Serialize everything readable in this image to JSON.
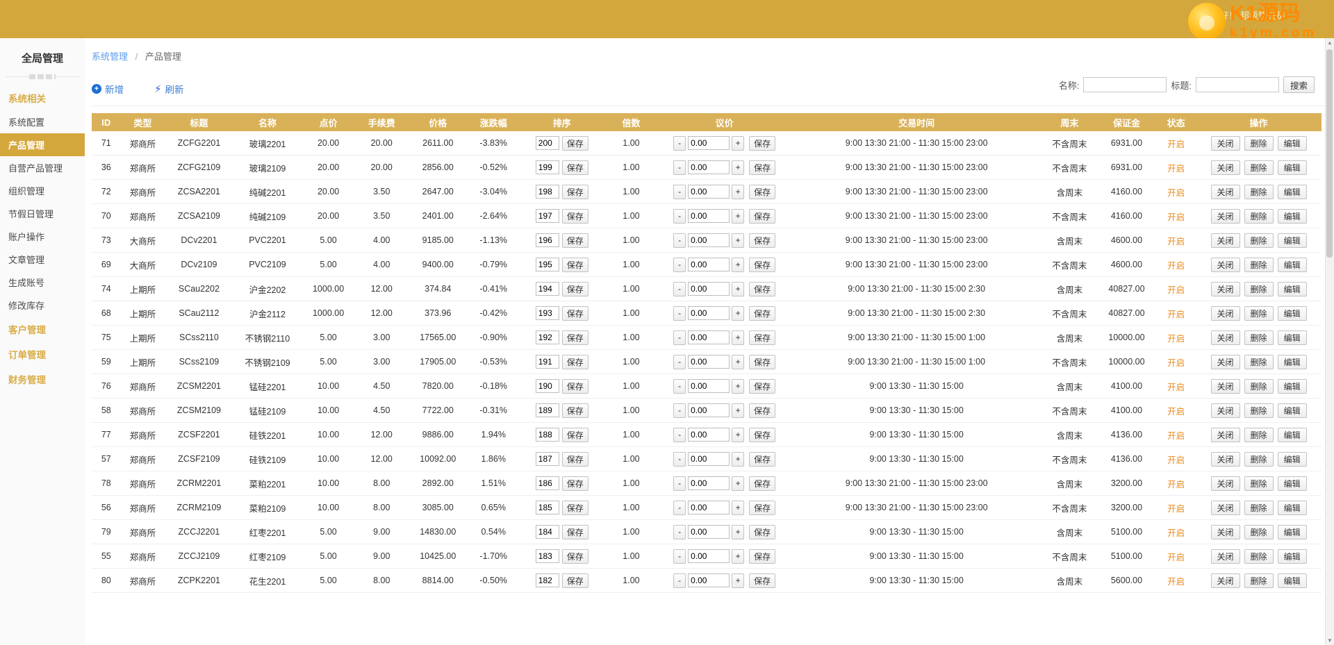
{
  "topbar": {
    "greeting": "你好！ 超级管理员",
    "logo_title": "K1源码",
    "logo_sub": "k1ym.com"
  },
  "sidebar": {
    "title": "全局管理",
    "groups": [
      {
        "label": "系统相关",
        "items": [
          {
            "label": "系统配置",
            "active": false
          },
          {
            "label": "产品管理",
            "active": true
          },
          {
            "label": "自营产品管理",
            "active": false
          },
          {
            "label": "组织管理",
            "active": false
          },
          {
            "label": "节假日管理",
            "active": false
          },
          {
            "label": "账户操作",
            "active": false
          },
          {
            "label": "文章管理",
            "active": false
          },
          {
            "label": "生成账号",
            "active": false
          },
          {
            "label": "修改库存",
            "active": false
          }
        ]
      },
      {
        "label": "客户管理",
        "items": []
      },
      {
        "label": "订单管理",
        "items": []
      },
      {
        "label": "财务管理",
        "items": []
      }
    ]
  },
  "breadcrumb": {
    "root": "系统管理",
    "separator": "/",
    "current": "产品管理"
  },
  "toolbar": {
    "add_label": "新增",
    "add_icon": "plus-circle-icon",
    "refresh_label": "刷新",
    "refresh_icon": "refresh-icon",
    "search": {
      "name_label": "名称:",
      "name_value": "",
      "title_label": "标题:",
      "title_value": "",
      "button_label": "搜索"
    }
  },
  "table": {
    "columns": [
      "ID",
      "类型",
      "标题",
      "名称",
      "点价",
      "手续费",
      "价格",
      "涨跌幅",
      "排序",
      "倍数",
      "议价",
      "交易时间",
      "周末",
      "保证金",
      "状态",
      "操作"
    ],
    "save_label": "保存",
    "minus_label": "-",
    "plus_label": "+",
    "status_on_label": "开启",
    "ops": [
      "关闭",
      "删除",
      "编辑"
    ],
    "rows": [
      {
        "id": "71",
        "type": "郑商所",
        "title": "ZCFG2201",
        "name": "玻璃2201",
        "point": "20.00",
        "fee": "20.00",
        "price": "2611.00",
        "change": "-3.83%",
        "sort": "200",
        "mult": "1.00",
        "bid": "0.00",
        "time": "9:00 13:30 21:00 - 11:30 15:00 23:00",
        "weekend": "不含周末",
        "margin": "6931.00",
        "status": "开启"
      },
      {
        "id": "36",
        "type": "郑商所",
        "title": "ZCFG2109",
        "name": "玻璃2109",
        "point": "20.00",
        "fee": "20.00",
        "price": "2856.00",
        "change": "-0.52%",
        "sort": "199",
        "mult": "1.00",
        "bid": "0.00",
        "time": "9:00 13:30 21:00 - 11:30 15:00 23:00",
        "weekend": "不含周末",
        "margin": "6931.00",
        "status": "开启"
      },
      {
        "id": "72",
        "type": "郑商所",
        "title": "ZCSA2201",
        "name": "纯碱2201",
        "point": "20.00",
        "fee": "3.50",
        "price": "2647.00",
        "change": "-3.04%",
        "sort": "198",
        "mult": "1.00",
        "bid": "0.00",
        "time": "9:00 13:30 21:00 - 11:30 15:00 23:00",
        "weekend": "含周末",
        "margin": "4160.00",
        "status": "开启"
      },
      {
        "id": "70",
        "type": "郑商所",
        "title": "ZCSA2109",
        "name": "纯碱2109",
        "point": "20.00",
        "fee": "3.50",
        "price": "2401.00",
        "change": "-2.64%",
        "sort": "197",
        "mult": "1.00",
        "bid": "0.00",
        "time": "9:00 13:30 21:00 - 11:30 15:00 23:00",
        "weekend": "不含周末",
        "margin": "4160.00",
        "status": "开启"
      },
      {
        "id": "73",
        "type": "大商所",
        "title": "DCv2201",
        "name": "PVC2201",
        "point": "5.00",
        "fee": "4.00",
        "price": "9185.00",
        "change": "-1.13%",
        "sort": "196",
        "mult": "1.00",
        "bid": "0.00",
        "time": "9:00 13:30 21:00 - 11:30 15:00 23:00",
        "weekend": "含周末",
        "margin": "4600.00",
        "status": "开启"
      },
      {
        "id": "69",
        "type": "大商所",
        "title": "DCv2109",
        "name": "PVC2109",
        "point": "5.00",
        "fee": "4.00",
        "price": "9400.00",
        "change": "-0.79%",
        "sort": "195",
        "mult": "1.00",
        "bid": "0.00",
        "time": "9:00 13:30 21:00 - 11:30 15:00 23:00",
        "weekend": "不含周末",
        "margin": "4600.00",
        "status": "开启"
      },
      {
        "id": "74",
        "type": "上期所",
        "title": "SCau2202",
        "name": "沪金2202",
        "point": "1000.00",
        "fee": "12.00",
        "price": "374.84",
        "change": "-0.41%",
        "sort": "194",
        "mult": "1.00",
        "bid": "0.00",
        "time": "9:00 13:30 21:00 - 11:30 15:00 2:30",
        "weekend": "含周末",
        "margin": "40827.00",
        "status": "开启"
      },
      {
        "id": "68",
        "type": "上期所",
        "title": "SCau2112",
        "name": "沪金2112",
        "point": "1000.00",
        "fee": "12.00",
        "price": "373.96",
        "change": "-0.42%",
        "sort": "193",
        "mult": "1.00",
        "bid": "0.00",
        "time": "9:00 13:30 21:00 - 11:30 15:00 2:30",
        "weekend": "不含周末",
        "margin": "40827.00",
        "status": "开启"
      },
      {
        "id": "75",
        "type": "上期所",
        "title": "SCss2110",
        "name": "不锈钢2110",
        "point": "5.00",
        "fee": "3.00",
        "price": "17565.00",
        "change": "-0.90%",
        "sort": "192",
        "mult": "1.00",
        "bid": "0.00",
        "time": "9:00 13:30 21:00 - 11:30 15:00 1:00",
        "weekend": "含周末",
        "margin": "10000.00",
        "status": "开启"
      },
      {
        "id": "59",
        "type": "上期所",
        "title": "SCss2109",
        "name": "不锈钢2109",
        "point": "5.00",
        "fee": "3.00",
        "price": "17905.00",
        "change": "-0.53%",
        "sort": "191",
        "mult": "1.00",
        "bid": "0.00",
        "time": "9:00 13:30 21:00 - 11:30 15:00 1:00",
        "weekend": "不含周末",
        "margin": "10000.00",
        "status": "开启"
      },
      {
        "id": "76",
        "type": "郑商所",
        "title": "ZCSM2201",
        "name": "锰硅2201",
        "point": "10.00",
        "fee": "4.50",
        "price": "7820.00",
        "change": "-0.18%",
        "sort": "190",
        "mult": "1.00",
        "bid": "0.00",
        "time": "9:00 13:30 - 11:30 15:00",
        "weekend": "含周末",
        "margin": "4100.00",
        "status": "开启"
      },
      {
        "id": "58",
        "type": "郑商所",
        "title": "ZCSM2109",
        "name": "锰硅2109",
        "point": "10.00",
        "fee": "4.50",
        "price": "7722.00",
        "change": "-0.31%",
        "sort": "189",
        "mult": "1.00",
        "bid": "0.00",
        "time": "9:00 13:30 - 11:30 15:00",
        "weekend": "不含周末",
        "margin": "4100.00",
        "status": "开启"
      },
      {
        "id": "77",
        "type": "郑商所",
        "title": "ZCSF2201",
        "name": "硅铁2201",
        "point": "10.00",
        "fee": "12.00",
        "price": "9886.00",
        "change": "1.94%",
        "sort": "188",
        "mult": "1.00",
        "bid": "0.00",
        "time": "9:00 13:30 - 11:30 15:00",
        "weekend": "含周末",
        "margin": "4136.00",
        "status": "开启"
      },
      {
        "id": "57",
        "type": "郑商所",
        "title": "ZCSF2109",
        "name": "硅铁2109",
        "point": "10.00",
        "fee": "12.00",
        "price": "10092.00",
        "change": "1.86%",
        "sort": "187",
        "mult": "1.00",
        "bid": "0.00",
        "time": "9:00 13:30 - 11:30 15:00",
        "weekend": "不含周末",
        "margin": "4136.00",
        "status": "开启"
      },
      {
        "id": "78",
        "type": "郑商所",
        "title": "ZCRM2201",
        "name": "菜粕2201",
        "point": "10.00",
        "fee": "8.00",
        "price": "2892.00",
        "change": "1.51%",
        "sort": "186",
        "mult": "1.00",
        "bid": "0.00",
        "time": "9:00 13:30 21:00 - 11:30 15:00 23:00",
        "weekend": "含周末",
        "margin": "3200.00",
        "status": "开启"
      },
      {
        "id": "56",
        "type": "郑商所",
        "title": "ZCRM2109",
        "name": "菜粕2109",
        "point": "10.00",
        "fee": "8.00",
        "price": "3085.00",
        "change": "0.65%",
        "sort": "185",
        "mult": "1.00",
        "bid": "0.00",
        "time": "9:00 13:30 21:00 - 11:30 15:00 23:00",
        "weekend": "不含周末",
        "margin": "3200.00",
        "status": "开启"
      },
      {
        "id": "79",
        "type": "郑商所",
        "title": "ZCCJ2201",
        "name": "红枣2201",
        "point": "5.00",
        "fee": "9.00",
        "price": "14830.00",
        "change": "0.54%",
        "sort": "184",
        "mult": "1.00",
        "bid": "0.00",
        "time": "9:00 13:30 - 11:30 15:00",
        "weekend": "含周末",
        "margin": "5100.00",
        "status": "开启"
      },
      {
        "id": "55",
        "type": "郑商所",
        "title": "ZCCJ2109",
        "name": "红枣2109",
        "point": "5.00",
        "fee": "9.00",
        "price": "10425.00",
        "change": "-1.70%",
        "sort": "183",
        "mult": "1.00",
        "bid": "0.00",
        "time": "9:00 13:30 - 11:30 15:00",
        "weekend": "不含周末",
        "margin": "5100.00",
        "status": "开启"
      },
      {
        "id": "80",
        "type": "郑商所",
        "title": "ZCPK2201",
        "name": "花生2201",
        "point": "5.00",
        "fee": "8.00",
        "price": "8814.00",
        "change": "-0.50%",
        "sort": "182",
        "mult": "1.00",
        "bid": "0.00",
        "time": "9:00 13:30 - 11:30 15:00",
        "weekend": "含周末",
        "margin": "5600.00",
        "status": "开启"
      }
    ]
  }
}
